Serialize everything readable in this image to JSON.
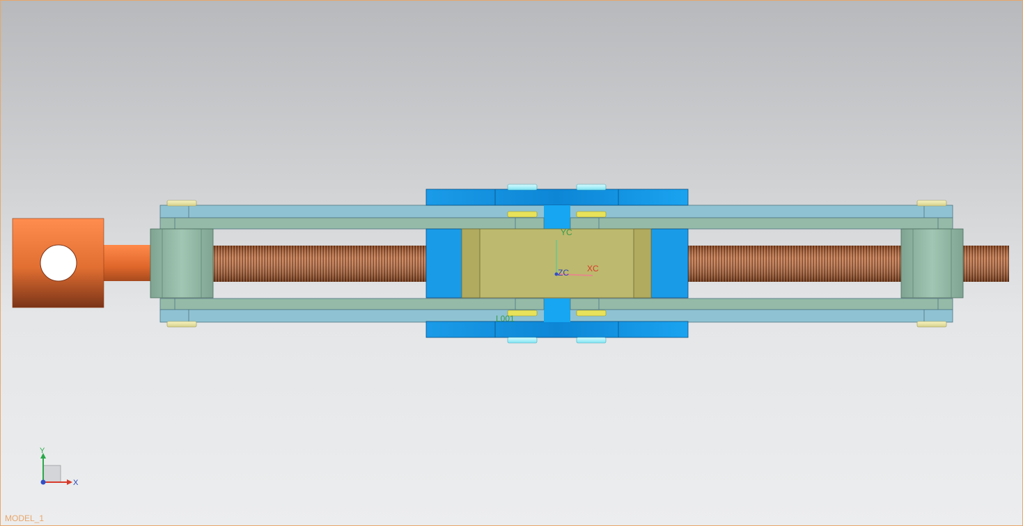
{
  "viewport": {
    "model_name": "MODEL_1",
    "wcs_labels": {
      "x": "XC",
      "y": "YC",
      "z": "ZC"
    },
    "triad_labels": {
      "x": "X",
      "y": "Y"
    },
    "part_labels": {
      "center_bottom": "L001"
    }
  },
  "colors": {
    "frame": "#e8a66a",
    "bg_top": "#b7b9bc",
    "bg_bottom": "#ecedee",
    "link_light_blue": "#8fc3d3",
    "bracket_blue": "#1a9be8",
    "block_olive": "#bdb96e",
    "threaded_rod": "#a85a2b",
    "eye_end_orange": "#f0874a",
    "pivot_green": "#90b8a5",
    "label_green": "#3a9a4a",
    "label_red": "#d83a2a"
  }
}
